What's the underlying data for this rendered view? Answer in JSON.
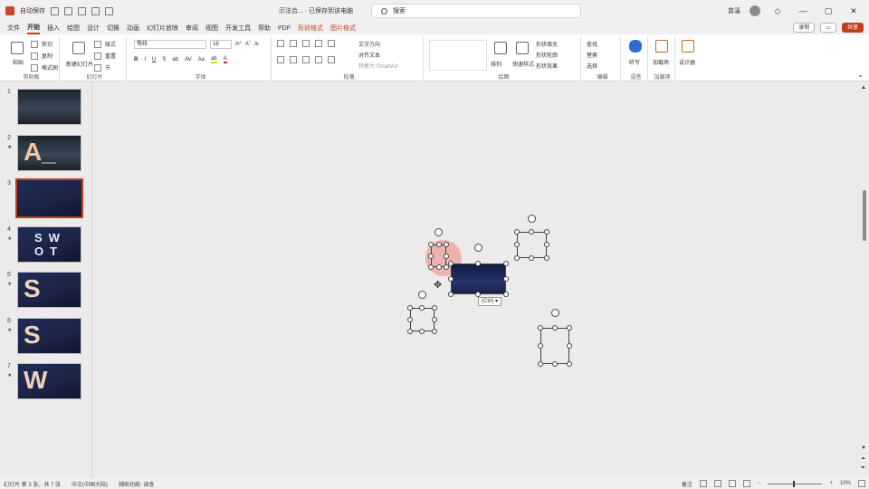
{
  "titlebar": {
    "autosave_label": "自动保存",
    "doc_title": "示法合... · 已保存到该电脑",
    "search_placeholder": "搜索",
    "user_name": "曾溪"
  },
  "menu": {
    "tabs": [
      "文件",
      "开始",
      "插入",
      "绘图",
      "设计",
      "切换",
      "动画",
      "幻灯片放映",
      "审阅",
      "视图",
      "开发工具",
      "帮助",
      "PDF",
      "形状格式",
      "图片格式"
    ],
    "active_index": 1,
    "contextual": [
      "形状格式",
      "图片格式"
    ],
    "record_label": "录制",
    "share_label": "共享"
  },
  "ribbon": {
    "groups": [
      {
        "label": "剪贴板",
        "items": [
          "粘贴",
          "剪切",
          "复制",
          "格式刷"
        ]
      },
      {
        "label": "幻灯片",
        "items": [
          "新建幻灯片",
          "版式",
          "重置",
          "节"
        ]
      },
      {
        "label": "字体",
        "font_name": "等线",
        "font_size": "18"
      },
      {
        "label": "段落",
        "items": [
          "文字方向",
          "对齐文本",
          "转换为 SmartArt"
        ]
      },
      {
        "label": "绘图",
        "items": [
          "排列",
          "快速样式",
          "形状填充",
          "形状轮廓",
          "形状效果"
        ]
      },
      {
        "label": "编辑",
        "items": [
          "查找",
          "替换",
          "选择"
        ]
      },
      {
        "label": "语音",
        "items": [
          "听写"
        ]
      },
      {
        "label": "加载项",
        "items": [
          "加载项"
        ]
      },
      {
        "label": "",
        "items": [
          "设计器"
        ]
      }
    ]
  },
  "slides": [
    {
      "num": "1",
      "star": "",
      "kind": "mountain",
      "letters": ""
    },
    {
      "num": "2",
      "star": "★",
      "kind": "mountain",
      "letters": "A_"
    },
    {
      "num": "3",
      "star": "",
      "kind": "blue",
      "letters": ""
    },
    {
      "num": "4",
      "star": "★",
      "kind": "blue",
      "letters": "SWOT"
    },
    {
      "num": "5",
      "star": "★",
      "kind": "blue",
      "letters": "S"
    },
    {
      "num": "6",
      "star": "★",
      "kind": "blue",
      "letters": "S"
    },
    {
      "num": "7",
      "star": "★",
      "kind": "blue",
      "letters": "W"
    }
  ],
  "selected_slide": "3",
  "canvas": {
    "paste_tag": "(Ctrl) ▾"
  },
  "status": {
    "slide_info": "幻灯片 第 3 张，共 7 张",
    "language": "中文(中国大陆)",
    "accessibility": "辅助功能: 调查",
    "notes_label": "备注",
    "zoom": "10%"
  },
  "colors": {
    "accent": "#c43e1c",
    "slide_bg": "#1d2447"
  }
}
